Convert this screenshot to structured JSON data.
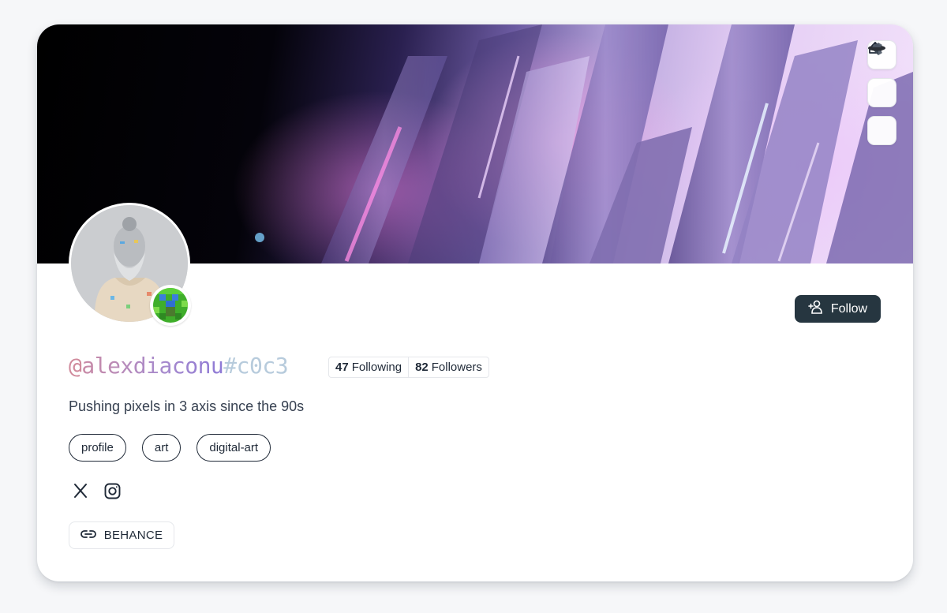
{
  "profile": {
    "handle_at": "@",
    "handle_name": "alexdiaconu",
    "handle_tag": "#c0c3",
    "bio": "Pushing pixels in 3 axis since the 90s"
  },
  "stats": {
    "following_count": "47",
    "following_label": "Following",
    "followers_count": "82",
    "followers_label": "Followers"
  },
  "actions": {
    "follow_label": "Follow",
    "side_icons": [
      "upload-icon",
      "app-logo-icon",
      "ufo-icon"
    ]
  },
  "tags": [
    "profile",
    "art",
    "digital-art"
  ],
  "socials": [
    "x-icon",
    "instagram-icon"
  ],
  "link": {
    "label": "BEHANCE",
    "icon": "link-icon"
  },
  "colors": {
    "follow_button": "#263640",
    "handle_gradient_start": "#c98aa5",
    "handle_gradient_end": "#8e7ad6",
    "handle_tag": "#b7cbdc"
  }
}
